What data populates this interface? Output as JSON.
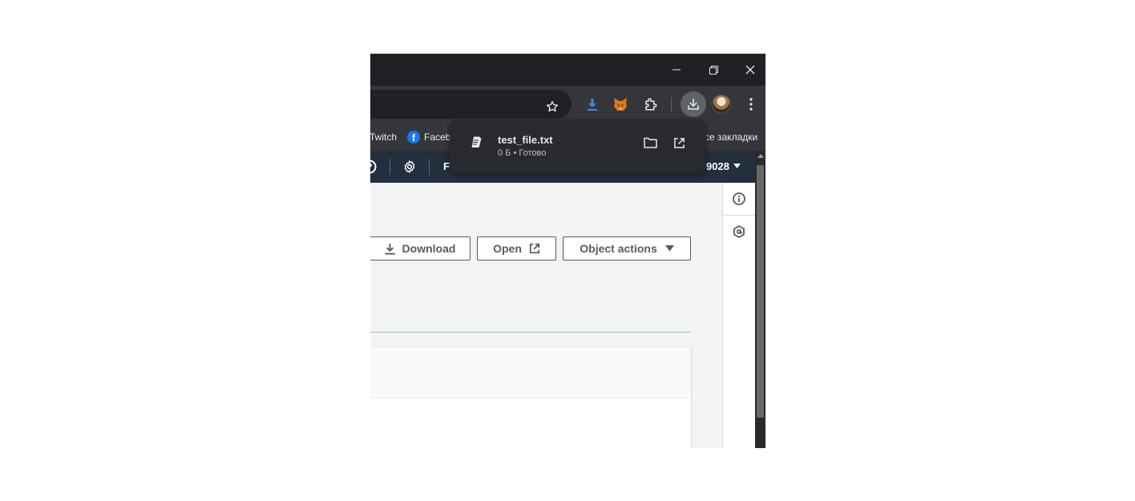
{
  "bookmarks": {
    "twitch_label": "Twitch",
    "facebook_label": "Faceb",
    "all_bookmarks_label": "се закладки"
  },
  "aws_nav": {
    "region_label": "F",
    "account_label": "9028"
  },
  "object_actions": {
    "download_label": "Download",
    "open_label": "Open",
    "object_actions_label": "Object actions"
  },
  "download_bubble": {
    "file_name": "test_file.txt",
    "file_status": "0 Б • Готово"
  },
  "colors": {
    "window_bg": "#202124",
    "toolbar_bg": "#35363a",
    "aws_nav_bg": "#232f3e",
    "content_bg": "#f2f3f3",
    "button_border": "#545b64"
  },
  "icons": [
    "minimize-icon",
    "restore-icon",
    "close-icon",
    "star-icon",
    "download-manager-extension-icon",
    "metamask-fox-icon",
    "puzzle-extension-icon",
    "download-icon",
    "profile-avatar",
    "kebab-menu-icon",
    "facebook-icon",
    "help-icon",
    "settings-gear-icon",
    "caret-down-icon",
    "info-icon",
    "hexagon-icon",
    "file-icon",
    "folder-icon",
    "external-link-icon"
  ]
}
